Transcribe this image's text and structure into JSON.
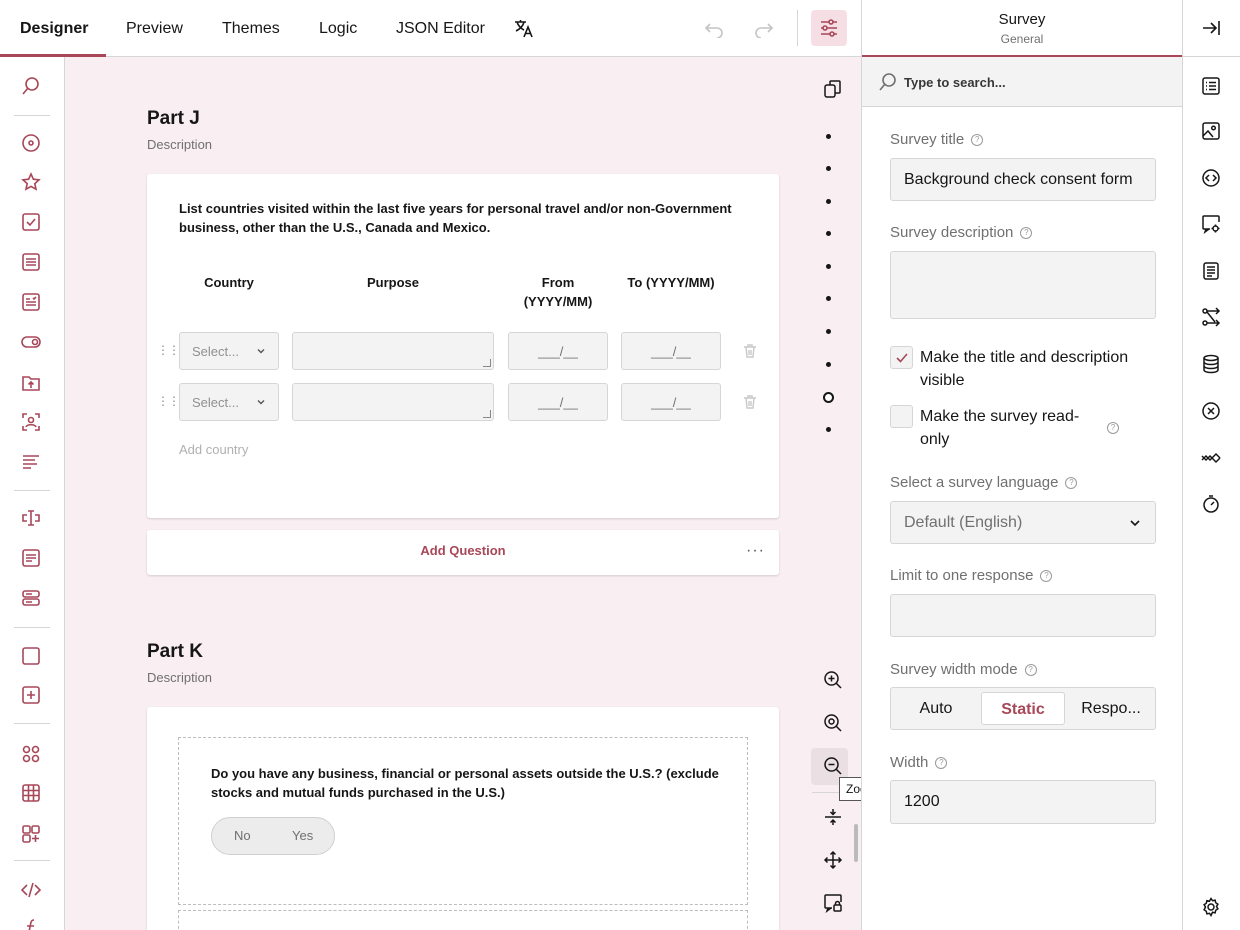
{
  "tabs": [
    "Designer",
    "Preview",
    "Themes",
    "Logic",
    "JSON Editor"
  ],
  "page_j": {
    "title": "Part J",
    "description": "Description",
    "question": "List countries visited within the last five years for personal travel and/or non-Government business, other than the U.S., Canada and Mexico.",
    "columns": [
      "Country",
      "Purpose",
      "From (YYYY/MM)",
      "To (YYYY/MM)"
    ],
    "select_placeholder": "Select...",
    "date_mask": "___/__",
    "add_row": "Add country",
    "add_question": "Add Question",
    "more": "···"
  },
  "page_k": {
    "title": "Part K",
    "description": "Description",
    "question": "Do you have any business, financial or personal assets outside the U.S.? (exclude stocks and mutual funds purchased in the U.S.)",
    "no": "No",
    "yes": "Yes"
  },
  "tooltip": "Zoom Out",
  "panel": {
    "title": "Survey",
    "subtitle": "General",
    "search_placeholder": "Type to search...",
    "survey_title_label": "Survey title",
    "survey_title_value": "Background check consent form",
    "survey_desc_label": "Survey description",
    "title_visible_label": "Make the title and description visible",
    "read_only_label": "Make the survey read-only",
    "language_label": "Select a survey language",
    "language_value": "Default (English)",
    "limit_label": "Limit to one response",
    "width_mode_label": "Survey width mode",
    "width_modes": [
      "Auto",
      "Static",
      "Respo..."
    ],
    "width_label": "Width",
    "width_value": "1200"
  },
  "colors": {
    "accent": "#a84758",
    "canvas": "#f9eef1"
  }
}
